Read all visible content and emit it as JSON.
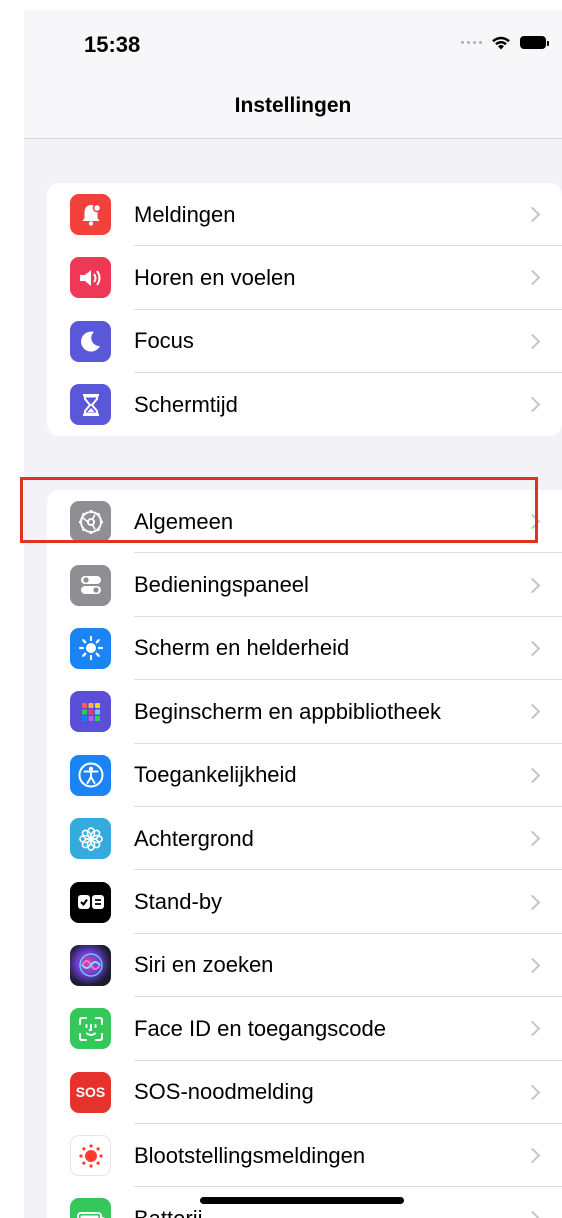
{
  "status_bar": {
    "time": "15:38",
    "icons": [
      "cellular-dots-icon",
      "wifi-icon",
      "battery-icon"
    ]
  },
  "nav": {
    "title": "Instellingen"
  },
  "groups": [
    {
      "items": [
        {
          "label": "Meldingen",
          "icon": "bell-icon",
          "color": "#f2403b"
        },
        {
          "label": "Horen en voelen",
          "icon": "speaker-icon",
          "color": "#ef3856"
        },
        {
          "label": "Focus",
          "icon": "moon-icon",
          "color": "#5b57d9"
        },
        {
          "label": "Schermtijd",
          "icon": "hourglass-icon",
          "color": "#5b57d9"
        }
      ]
    },
    {
      "items": [
        {
          "label": "Algemeen",
          "icon": "gear-icon",
          "color": "#8e8e93",
          "highlighted": true
        },
        {
          "label": "Bedieningspaneel",
          "icon": "toggles-icon",
          "color": "#8e8e93"
        },
        {
          "label": "Scherm en helderheid",
          "icon": "sun-icon",
          "color": "#1a84f5"
        },
        {
          "label": "Beginscherm en appbibliotheek",
          "icon": "app-grid-icon",
          "color": "#5a4fd6"
        },
        {
          "label": "Toegankelijkheid",
          "icon": "accessibility-icon",
          "color": "#1a84f5"
        },
        {
          "label": "Achtergrond",
          "icon": "flower-icon",
          "color": "#35aadc"
        },
        {
          "label": "Stand-by",
          "icon": "standby-icon",
          "color": "#000000"
        },
        {
          "label": "Siri en zoeken",
          "icon": "siri-icon",
          "color": "#1c1c2e"
        },
        {
          "label": "Face ID en toegangscode",
          "icon": "face-id-icon",
          "color": "#34c759"
        },
        {
          "label": "SOS-noodmelding",
          "icon": "sos-icon",
          "color": "#e5322d",
          "icon_text": "SOS"
        },
        {
          "label": "Blootstellingsmeldingen",
          "icon": "exposure-icon",
          "color": "#ffffff"
        },
        {
          "label": "Batterij",
          "icon": "battery-icon",
          "color": "#34c759"
        }
      ]
    }
  ]
}
